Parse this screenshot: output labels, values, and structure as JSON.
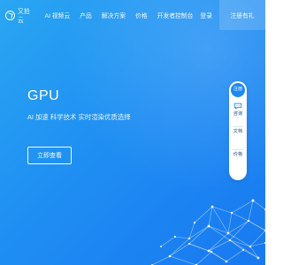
{
  "header": {
    "brand": "又拍云",
    "nav": [
      "AI 视频云",
      "产品",
      "解决方案",
      "价格",
      "开发者"
    ],
    "console": "控制台",
    "login": "登录",
    "register": "注册有礼"
  },
  "hero": {
    "title": "GPU",
    "subtitle": "AI 加速 科学技术 实时渲染优质选择",
    "cta": "立即查看"
  },
  "floating": {
    "register": "注册",
    "consult": "咨询",
    "doc": "文档",
    "price": "价格"
  },
  "icons": {
    "logo": "logo-icon",
    "chat": "chat-icon"
  },
  "colors": {
    "background_start": "#2aa6f2",
    "background_end": "#1878f0",
    "text": "#ffffff",
    "panel_accent": "#1d8af0",
    "panel_text": "#1f4f8b"
  }
}
